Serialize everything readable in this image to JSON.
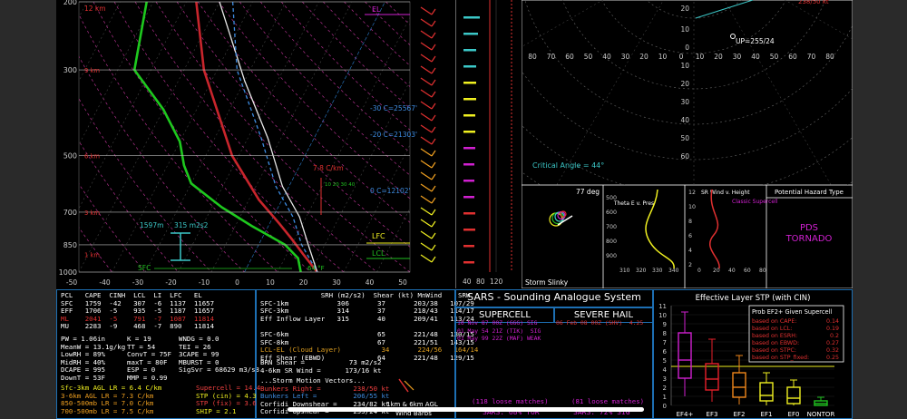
{
  "chart_data": [
    {
      "type": "line",
      "name": "skew-t",
      "pressure_axis": [
        200,
        300,
        500,
        700,
        850,
        1000
      ],
      "temperature_axis": [
        -50,
        -40,
        -30,
        -20,
        -10,
        0,
        10,
        20,
        30,
        40,
        50
      ],
      "series": [
        {
          "name": "temperature",
          "color": "#c8252c",
          "points": [
            [
              -57,
              200
            ],
            [
              -44,
              300
            ],
            [
              -22,
              500
            ],
            [
              -7,
              650
            ],
            [
              3,
              750
            ],
            [
              9,
              820
            ],
            [
              15,
              900
            ],
            [
              22,
              1000
            ]
          ]
        },
        {
          "name": "dewpoint",
          "color": "#1ec81e",
          "points": [
            [
              -72,
              200
            ],
            [
              -65,
              300
            ],
            [
              -50,
              380
            ],
            [
              -40,
              460
            ],
            [
              -35,
              530
            ],
            [
              -30,
              590
            ],
            [
              -17,
              680
            ],
            [
              -5,
              760
            ],
            [
              8,
              850
            ],
            [
              14,
              920
            ],
            [
              17,
              1000
            ]
          ]
        },
        {
          "name": "parcel",
          "color": "#e8e8e8",
          "points": [
            [
              -50,
              200
            ],
            [
              -30,
              320
            ],
            [
              -14,
              450
            ],
            [
              -2,
              600
            ],
            [
              8,
              720
            ],
            [
              15,
              850
            ],
            [
              22,
              1000
            ]
          ]
        },
        {
          "name": "virtual temperature",
          "color": "#3d8be0",
          "points": [
            [
              -46,
              200
            ],
            [
              -34,
              300
            ],
            [
              -16,
              450
            ],
            [
              -4,
              600
            ],
            [
              6,
              720
            ],
            [
              13,
              850
            ],
            [
              22,
              1000
            ]
          ]
        }
      ],
      "labels": {
        "top_label": "12 km",
        "el": "EL",
        "lfc": "LFC",
        "lcl": "LCL",
        "sfc": "SFC",
        "height_markers": [
          "9 km",
          "6 km",
          "3 km",
          "1 km"
        ],
        "isotherms": [
          "-30 C=25567'",
          "-20 C=21303'",
          "0 C=12102'"
        ],
        "lapse": "7.8 C/km",
        "lapse_sub": "10 20 30 40",
        "inflow_height": "1597m",
        "inflow_srh": "315 m2s2",
        "sfc_temp": "64 °F"
      }
    },
    {
      "type": "scatter",
      "name": "hodograph",
      "rings_kt": [
        10,
        20,
        30,
        40,
        50,
        60,
        70,
        80
      ],
      "x_ticks": [
        80,
        70,
        60,
        50,
        40,
        30,
        20,
        10,
        0,
        10,
        20,
        30,
        40,
        50,
        60,
        70,
        80
      ],
      "y_ticks": [
        10,
        0,
        10,
        20,
        30,
        40,
        50,
        60
      ],
      "critical_angle": "Critical Angle = 44°",
      "storm_motion_label": "UP=255/24",
      "top_value": "20",
      "corner_label": "238/50 kt"
    },
    {
      "type": "bar",
      "name": "effective-layer-stp",
      "title": "Effective Layer STP (with CIN)",
      "categories": [
        "EF4+",
        "EF3",
        "EF2",
        "EF1",
        "EF0",
        "NONTOR"
      ],
      "ylim": [
        0,
        11
      ],
      "y_ticks": [
        0,
        1,
        2,
        3,
        4,
        5,
        6,
        7,
        8,
        9,
        10,
        11
      ],
      "boxes": [
        {
          "name": "EF4+",
          "color": "#d020d0",
          "min": 1,
          "q1": 3,
          "median": 5,
          "q3": 8,
          "max": 10.3
        },
        {
          "name": "EF3",
          "color": "#e8202a",
          "min": 0.4,
          "q1": 1.7,
          "median": 2.9,
          "q3": 4.6,
          "max": 7.3
        },
        {
          "name": "EF2",
          "color": "#f0861a",
          "min": 0.1,
          "q1": 0.9,
          "median": 2.0,
          "q3": 3.6,
          "max": 5.5
        },
        {
          "name": "EF1",
          "color": "#f0f020",
          "min": 0,
          "q1": 0.5,
          "median": 1.1,
          "q3": 2.5,
          "max": 3.6
        },
        {
          "name": "EF0",
          "color": "#f0f020",
          "min": 0,
          "q1": 0.2,
          "median": 0.8,
          "q3": 2.0,
          "max": 2.8
        },
        {
          "name": "NONTOR",
          "color": "#20c020",
          "min": 0,
          "q1": 0,
          "median": 0.2,
          "q3": 0.5,
          "max": 0.9
        }
      ]
    }
  ],
  "wind_speed_axis": [
    "40",
    "80",
    "120"
  ],
  "inferred": {
    "label": "77 deg",
    "theta_e_label": "Theta E v. Pres",
    "sr_wind_label": "SR Wind v. Height",
    "classic_label": "Classic Supercell",
    "storm_slinky": "Storm Slinky",
    "theta_p": [
      "500",
      "600",
      "700",
      "800",
      "900"
    ],
    "theta_x": [
      "310",
      "320",
      "330",
      "340"
    ],
    "sr_h": [
      "12",
      "10",
      "8",
      "6",
      "4",
      "2"
    ],
    "sr_x": [
      "0",
      "20",
      "40",
      "60",
      "80"
    ]
  },
  "hazard": {
    "title": "Potential Hazard Type",
    "line1": "PDS",
    "line2": "TORNADO"
  },
  "parcel_table": {
    "header": [
      "PCL",
      "CAPE",
      "CINH",
      "LCL",
      "LI",
      "LFC",
      "EL"
    ],
    "rows": [
      {
        "c": "#ffffff",
        "v": [
          "SFC",
          "1759",
          "-42",
          "307",
          "-6",
          "1137",
          "11657"
        ]
      },
      {
        "c": "#ffffff",
        "v": [
          "EFF",
          "1706",
          "-5",
          "935",
          "-5",
          "1187",
          "11657"
        ]
      },
      {
        "c": "#e03030",
        "v": [
          "ML",
          "2041",
          "-5",
          "791",
          "-7",
          "1087",
          "11814"
        ]
      },
      {
        "c": "#ffffff",
        "v": [
          "MU",
          "2283",
          "-9",
          "468",
          "-7",
          "890",
          "11814"
        ]
      }
    ]
  },
  "thermo_left": [
    "PW = 1.06in",
    "MeanW = 13.1g/kg",
    "LowRH = 89%",
    "MidRH = 40%",
    "DCAPE = 995",
    "DownT = 53F"
  ],
  "thermo_mid": [
    "K = 19",
    "TT = 54",
    "ConvT = 75F",
    "maxT = 80F",
    "ESP = 0",
    "MMP = 0.99"
  ],
  "thermo_right": [
    "WNDG = 0.0",
    "TEI = 26",
    "3CAPE = 99",
    "MBURST = 0",
    "",
    "SigSvr = 68629 m3/s3"
  ],
  "lapse_rates": [
    "Sfc-3km AGL LR = 6.4 C/km",
    "3-6km AGL LR = 7.3 C/km",
    "850-500mb LR = 7.0 C/km",
    "700-500mb LR = 7.5 C/km"
  ],
  "composite": [
    {
      "c": "#f04040",
      "t": "Supercell = 14.4"
    },
    {
      "c": "#f0f020",
      "t": "STP (cin) = 4.3"
    },
    {
      "c": "#f04040",
      "t": "STP (fix) = 3.6"
    },
    {
      "c": "#f0f020",
      "t": "SHIP = 2.1"
    }
  ],
  "kinematic_header": [
    "SRH (m2/s2)",
    "Shear (kt)",
    "MnWind",
    "SRW"
  ],
  "kinematic_rows": [
    {
      "c": "#ffffff",
      "v": [
        "SFC-1km",
        "306",
        "37",
        "203/38",
        "107/29"
      ]
    },
    {
      "c": "#ffffff",
      "v": [
        "SFC-3km",
        "314",
        "37",
        "218/43",
        "114/17"
      ]
    },
    {
      "c": "#ffffff",
      "v": [
        "Eff Inflow Layer",
        "315",
        "40",
        "209/41",
        "113/24"
      ]
    },
    {
      "c": "#ffffff",
      "v": [
        "",
        "",
        "",
        "",
        ""
      ]
    },
    {
      "c": "#ffffff",
      "v": [
        "SFC-6km",
        "",
        "65",
        "221/48",
        "130/15"
      ]
    },
    {
      "c": "#ffffff",
      "v": [
        "SFC-8km",
        "",
        "67",
        "221/51",
        "143/15"
      ]
    },
    {
      "c": "#e0a020",
      "v": [
        "LCL-EL (Cloud Layer)",
        "",
        "34",
        "224/56",
        "164/14"
      ]
    },
    {
      "c": "#ffffff",
      "v": [
        "Eff Shear (EBWD)",
        "",
        "64",
        "221/48",
        "129/15"
      ]
    }
  ],
  "shear_extra": [
    "BRN Shear =           73 m2/s2",
    "4-6km SR Wind =      173/16 kt"
  ],
  "storm_motion": {
    "header": "...Storm Motion Vectors...",
    "rows": [
      {
        "c": "#f04040",
        "t": "Bunkers Right =        238/50 kt"
      },
      {
        "c": "#3d8be0",
        "t": "Bunkers Left =         206/55 kt"
      },
      {
        "c": "#ffffff",
        "t": "Corfidi Downshear =    234/82 kt"
      },
      {
        "c": "#ffffff",
        "t": "Corfidi Upshear =      255/24 kt"
      }
    ]
  },
  "wind_barbs": {
    "label": "1km & 6km AGL",
    "sub": "Wind Barbs"
  },
  "sars": {
    "title": "SARS - Sounding Analogue System",
    "supercell_head": "SUPERCELL",
    "hail_head": "SEVERE HAIL",
    "supercell_rows": [
      "16 Nov 87 00Z (GGG) SIG",
      "01 May 54 21Z (TIK)  SIG",
      "01 May 99 22Z (MAF) WEAK"
    ],
    "hail_rows": [
      "06 Feb 08 00Z (SHV)  4.25"
    ],
    "supercell_matches": "(118 loose matches)",
    "hail_matches": "(81 loose matches)",
    "supercell_tor": "SARS: 68% TOR",
    "hail_sig": "SARS: 72% SIG"
  },
  "ef_prob": {
    "title": "Prob EF2+ Given Supercell",
    "rows": [
      [
        "based on CAPE:",
        "0.14"
      ],
      [
        "based on LCL:",
        "0.19"
      ],
      [
        "based on ESRH:",
        "0.2"
      ],
      [
        "based on EBWD:",
        "0.27"
      ],
      [
        "based on STPC:",
        "0.32"
      ],
      [
        "based on STP_fixed:",
        "0.25"
      ]
    ]
  }
}
